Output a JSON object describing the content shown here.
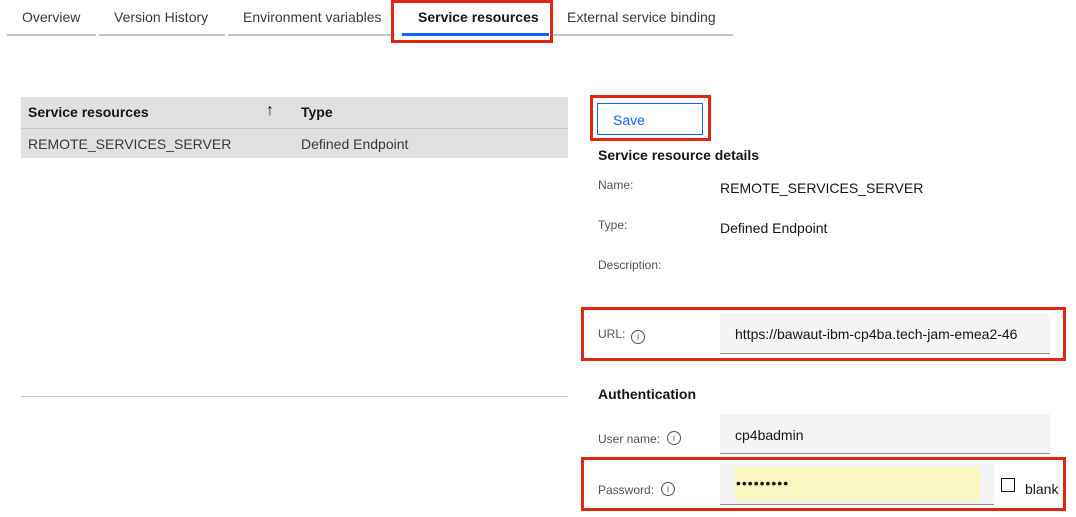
{
  "tabs": [
    {
      "label": "Overview"
    },
    {
      "label": "Version History"
    },
    {
      "label": "Environment variables"
    },
    {
      "label": "Service resources",
      "active": true
    },
    {
      "label": "External service binding"
    }
  ],
  "table": {
    "headers": [
      "Service resources",
      "Type"
    ],
    "sort_icon": "arrow-up-icon",
    "rows": [
      {
        "name": "REMOTE_SERVICES_SERVER",
        "type": "Defined Endpoint"
      }
    ]
  },
  "details": {
    "save_label": "Save",
    "title": "Service resource details",
    "name_label": "Name:",
    "name_value": "REMOTE_SERVICES_SERVER",
    "type_label": "Type:",
    "type_value": "Defined Endpoint",
    "description_label": "Description:",
    "url_label": "URL:",
    "url_value": "https://bawaut-ibm-cp4ba.tech-jam-emea2-46",
    "auth_title": "Authentication",
    "username_label": "User name:",
    "username_value": "cp4badmin",
    "password_label": "Password:",
    "password_value": "•••••••••",
    "blank_label": "blank"
  },
  "colors": {
    "accent": "#0f62fe",
    "highlight_border": "#e0270f",
    "autofill": "#faf7c0"
  }
}
